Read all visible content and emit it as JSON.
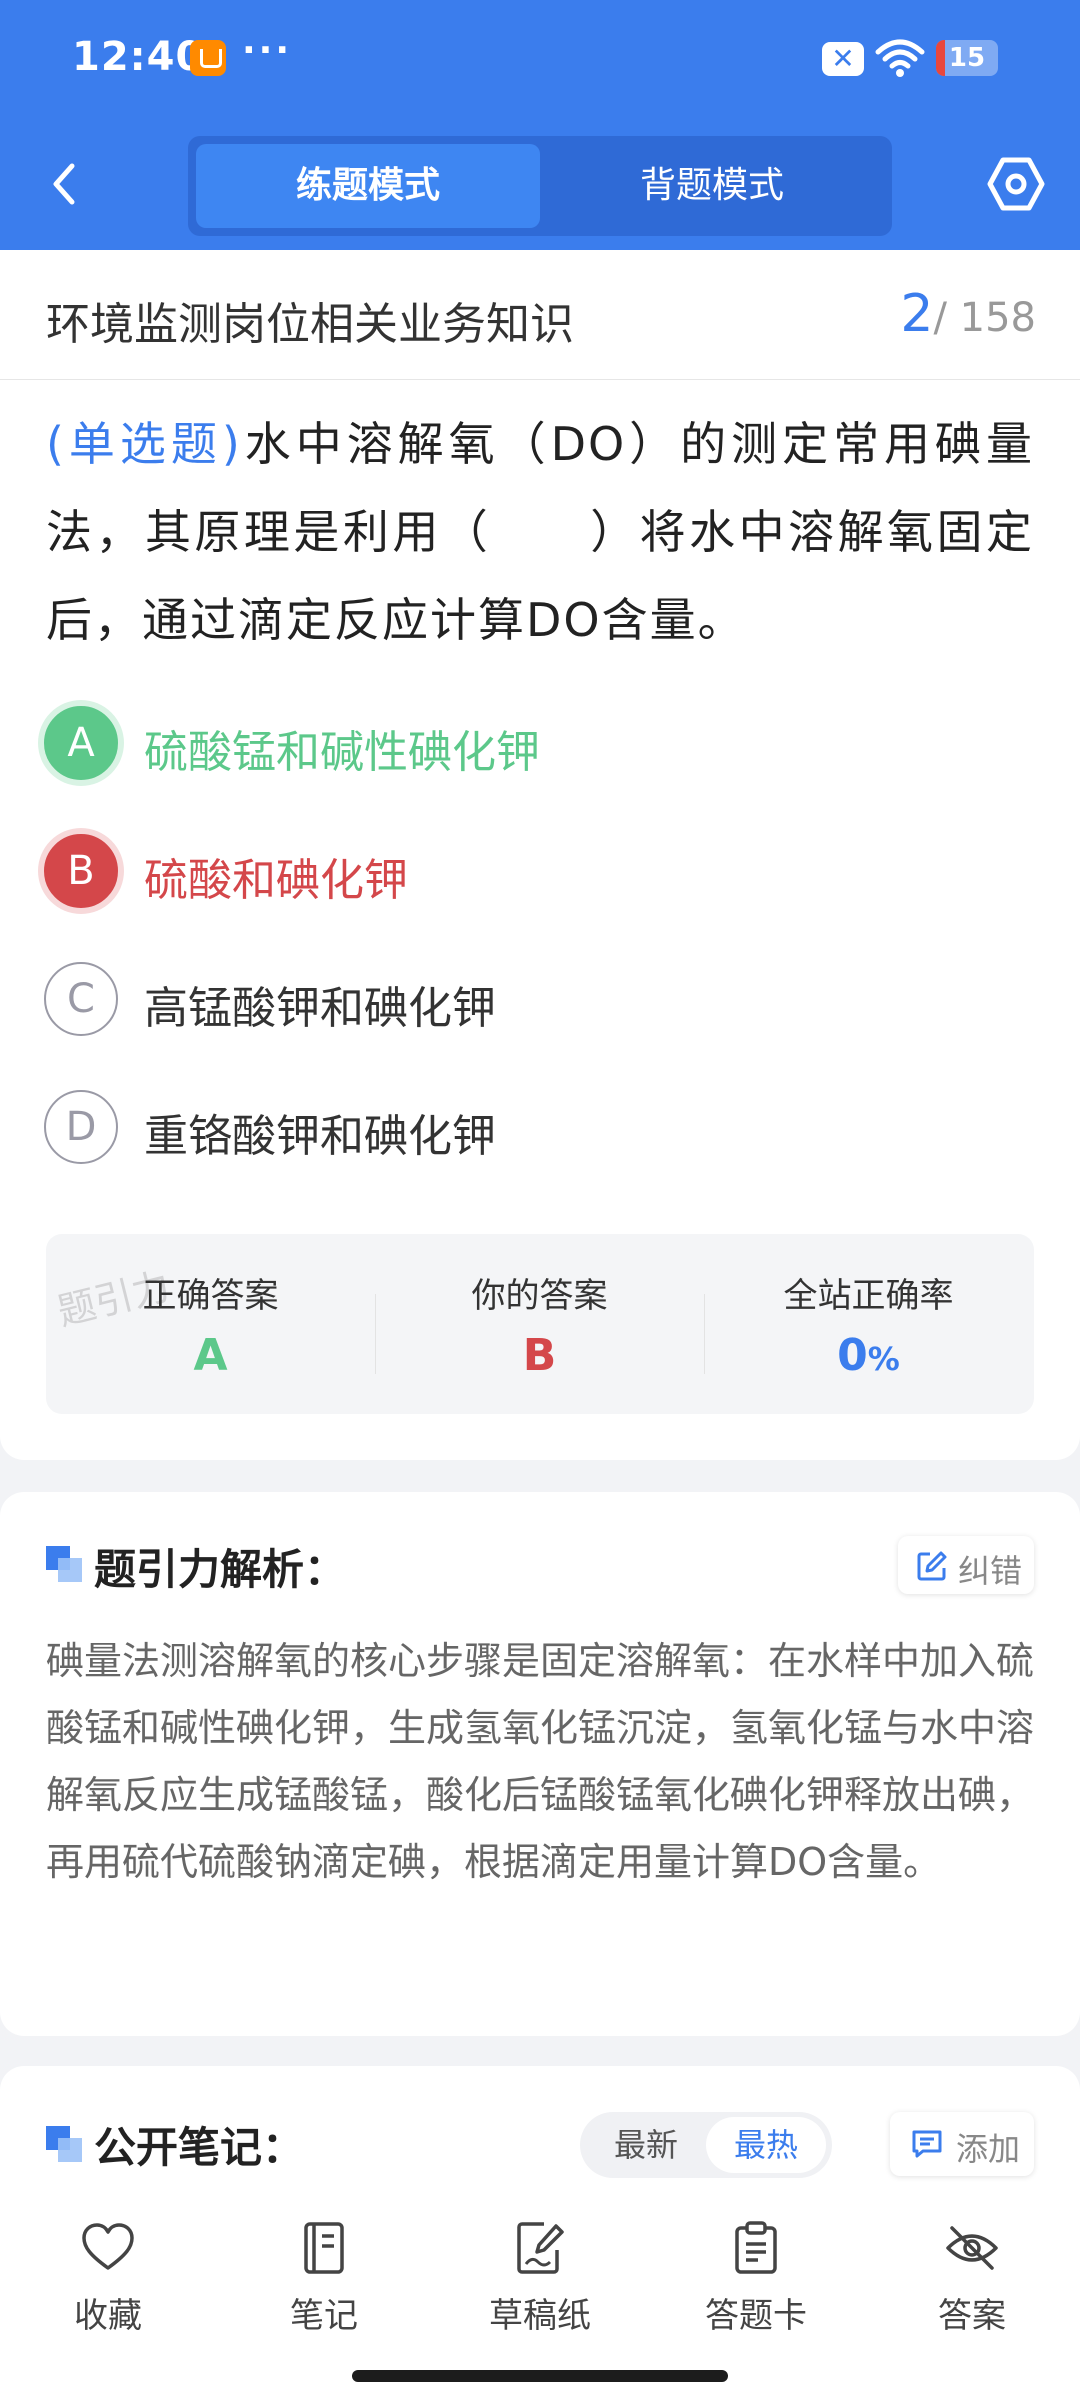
{
  "status_bar": {
    "time": "12:40",
    "dots": "···",
    "battery": "15",
    "battery_level": 0.15
  },
  "nav": {
    "tabs": [
      {
        "label": "练题模式",
        "active": true
      },
      {
        "label": "背题模式",
        "active": false
      }
    ]
  },
  "question": {
    "bank_title": "环境监测岗位相关业务知识",
    "current": "2",
    "total": "/ 158",
    "type": "(单选题)",
    "text": "水中溶解氧（DO）的测定常用碘量法，其原理是利用（　　）将水中溶解氧固定后，通过滴定反应计算DO含量。",
    "options": [
      {
        "letter": "A",
        "text": "硫酸锰和碱性碘化钾",
        "state": "correct"
      },
      {
        "letter": "B",
        "text": "硫酸和碘化钾",
        "state": "wrong"
      },
      {
        "letter": "C",
        "text": "高锰酸钾和碘化钾",
        "state": "normal"
      },
      {
        "letter": "D",
        "text": "重铬酸钾和碘化钾",
        "state": "normal"
      }
    ]
  },
  "answer_summary": {
    "watermark": "题引力",
    "correct_label": "正确答案",
    "correct_value": "A",
    "yours_label": "你的答案",
    "yours_value": "B",
    "rate_label": "全站正确率",
    "rate_value": "0",
    "rate_unit": "%"
  },
  "analysis": {
    "title": "题引力解析：",
    "correction_label": "纠错",
    "text": "碘量法测溶解氧的核心步骤是固定溶解氧：在水样中加入硫酸锰和碱性碘化钾，生成氢氧化锰沉淀，氢氧化锰与水中溶解氧反应生成锰酸锰，酸化后锰酸锰氧化碘化钾释放出碘，再用硫代硫酸钠滴定碘，根据滴定用量计算DO含量。"
  },
  "notes": {
    "title": "公开笔记：",
    "sort_new": "最新",
    "sort_hot": "最热",
    "add_label": "添加"
  },
  "toolbar": {
    "favorite": "收藏",
    "notes": "笔记",
    "draft": "草稿纸",
    "answer_card": "答题卡",
    "answer": "答案"
  },
  "colors": {
    "primary": "#3b7ded",
    "correct": "#5cc88a",
    "wrong": "#d4474a"
  }
}
